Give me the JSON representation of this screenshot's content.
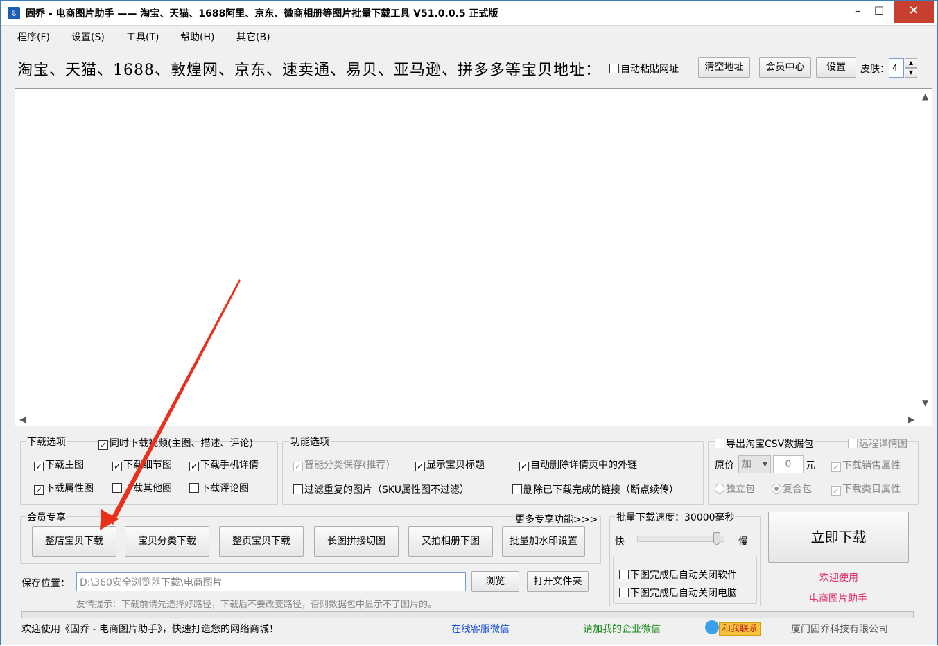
{
  "window": {
    "title": "固乔 - 电商图片助手 —— 淘宝、天猫、1688阿里、京东、微商相册等图片批量下载工具 V51.0.0.5 正式版",
    "min_glyph": "–",
    "max_glyph": "☐",
    "close_glyph": "✕"
  },
  "menu": [
    "程序(F)",
    "设置(S)",
    "工具(T)",
    "帮助(H)",
    "其它(B)"
  ],
  "address": {
    "label": "淘宝、天猫、1688、敦煌网、京东、速卖通、易贝、亚马逊、拼多多等宝贝地址：",
    "auto_paste": "自动粘贴网址",
    "clear_btn": "清空地址",
    "member_btn": "会员中心",
    "settings_btn": "设置",
    "skin_label": "皮肤：",
    "skin_value": "4"
  },
  "download_options": {
    "title": "下载选项",
    "video": "同时下载视频(主图、描述、评论)",
    "main_img": "下载主图",
    "detail_img": "下载细节图",
    "mobile_detail": "下载手机详情",
    "attr_img": "下载属性图",
    "other_img": "下载其他图",
    "review_img": "下载评论图"
  },
  "function_options": {
    "title": "功能选项",
    "smart_save": "智能分类保存(推荐)",
    "show_title": "显示宝贝标题",
    "auto_delete_links": "自动删除详情页中的外链",
    "filter_dup": "过滤重复的图片（SKU属性图不过滤）",
    "delete_done": "删除已下载完成的链接（断点续传）"
  },
  "csv_options": {
    "export_csv": "导出淘宝CSV数据包",
    "remote_detail": "远程详情图",
    "price_label": "原价",
    "price_op": "加",
    "price_value": "0",
    "price_unit": "元",
    "sales_attr": "下载销售属性",
    "single_pkg": "独立包",
    "combo_pkg": "复合包",
    "category_attr": "下载类目属性"
  },
  "member": {
    "title": "会员专享",
    "more": "更多专享功能>>>",
    "buttons": [
      "整店宝贝下载",
      "宝贝分类下载",
      "整页宝贝下载",
      "长图拼接切图",
      "又拍相册下图",
      "批量加水印设置"
    ]
  },
  "speed": {
    "title": "批量下载速度：30000毫秒",
    "fast": "快",
    "slow": "慢",
    "level": 0.95,
    "close_soft": "下图完成后自动关闭软件",
    "close_pc": "下图完成后自动关闭电脑"
  },
  "download_now": "立即下载",
  "welcome_line1": "欢迎使用",
  "welcome_line2": "电商图片助手",
  "save": {
    "label": "保存位置：",
    "path": "D:\\360安全浏览器下载\\电商图片",
    "browse": "浏览",
    "open_folder": "打开文件夹",
    "tip": "友情提示：下载前请先选择好路径，下载后不要改变路径，否则数据包中显示不了图片的。"
  },
  "status": {
    "welcome": "欢迎使用《固乔 - 电商图片助手》，快速打造您的网络商城！",
    "wechat_service": "在线客服微信",
    "enterprise_wechat": "请加我的企业微信",
    "contact": "和我联系",
    "company": "厦门固乔科技有限公司"
  },
  "colors": {
    "link_blue": "#1a4fd6",
    "link_green": "#1a8a1a",
    "welcome_red": "#e0306a",
    "arrow_red": "#e8301c",
    "close_red": "#c7402f"
  },
  "icons": {
    "app": "download-app-icon",
    "scroll_up": "▲",
    "scroll_down": "▼",
    "scroll_left": "◀",
    "scroll_right": "▶",
    "spin_up": "▲",
    "spin_down": "▼",
    "dropdown": "▾",
    "check": "✓"
  }
}
